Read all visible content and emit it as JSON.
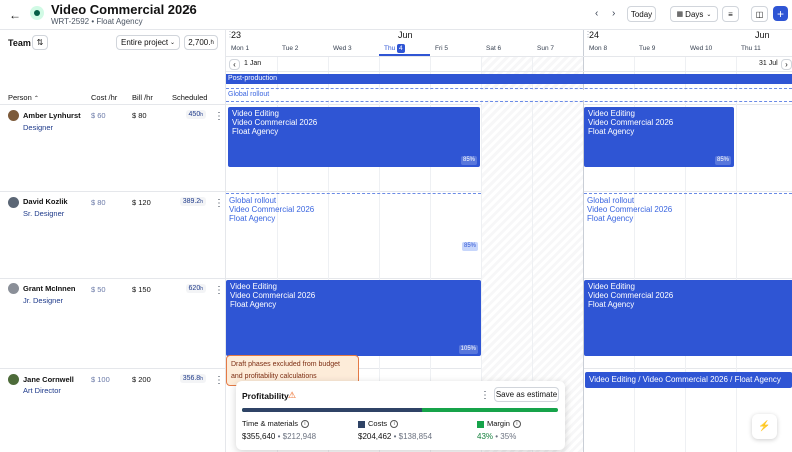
{
  "header": {
    "title": "Video Commercial 2026",
    "subtitle": "WRT-2592 • Float Agency",
    "today_label": "Today",
    "view_label": "Days"
  },
  "team": {
    "label": "Team",
    "range_select": "Entire project",
    "total_hours": "2,700.",
    "total_unit": "h",
    "columns": {
      "person": "Person",
      "cost": "Cost /hr",
      "bill": "Bill /hr",
      "scheduled": "Scheduled"
    },
    "people": [
      {
        "name": "Amber Lynhurst",
        "role": "Designer",
        "cost": "$ 60",
        "bill": "$ 80",
        "scheduled": "450",
        "unit": "h"
      },
      {
        "name": "David Kozlik",
        "role": "Sr. Designer",
        "cost": "$ 80",
        "bill": "$ 120",
        "scheduled": "389.2",
        "unit": "h"
      },
      {
        "name": "Grant McInnen",
        "role": "Jr. Designer",
        "cost": "$ 50",
        "bill": "$ 150",
        "scheduled": "620",
        "unit": "h"
      },
      {
        "name": "Jane Cornwell",
        "role": "Art Director",
        "cost": "$ 100",
        "bill": "$ 200",
        "scheduled": "356.8",
        "unit": "h"
      }
    ]
  },
  "timeline": {
    "week1": {
      "num": "23",
      "month": "Jun"
    },
    "week2": {
      "num": "24",
      "month": "Jun"
    },
    "days": [
      "Mon 1",
      "Tue 2",
      "Wed 3",
      "Thu",
      "Fri 5",
      "Sat 6",
      "Sun 7",
      "Mon 8",
      "Tue 9",
      "Wed 10",
      "Thu 11"
    ],
    "today_num": "4",
    "range_start": "1 Jan",
    "range_end": "31 Jul",
    "phase_post": "Post-production",
    "phase_global": "Global rollout",
    "blocks": {
      "editing": [
        "Video Editing",
        "Video Commercial 2026",
        "Float Agency"
      ],
      "rollout": [
        "Global rollout",
        "Video Commercial 2026",
        "Float Agency"
      ],
      "amber_pct": "85%",
      "david_pct": "85%",
      "grant_pct": "105%",
      "jane_inline": "Video Editing / Video Commercial 2026 / Float Agency"
    }
  },
  "profitability": {
    "tooltip_line1": "Draft phases excluded from budget",
    "tooltip_line2": "and profitability calculations",
    "title": "Profitability",
    "save_label": "Save as estimate",
    "bar_cost_fraction": 0.57,
    "colors": {
      "costs": "#2f4366",
      "margin": "#16a34a",
      "accent": "#2f55d4"
    },
    "metrics": {
      "time_label": "Time & materials",
      "time_value": "$355,640",
      "time_secondary": "$212,948",
      "costs_label": "Costs",
      "costs_value": "$204,462",
      "costs_secondary": "$138,854",
      "margin_label": "Margin",
      "margin_value": "43%",
      "margin_secondary": "35%"
    }
  }
}
